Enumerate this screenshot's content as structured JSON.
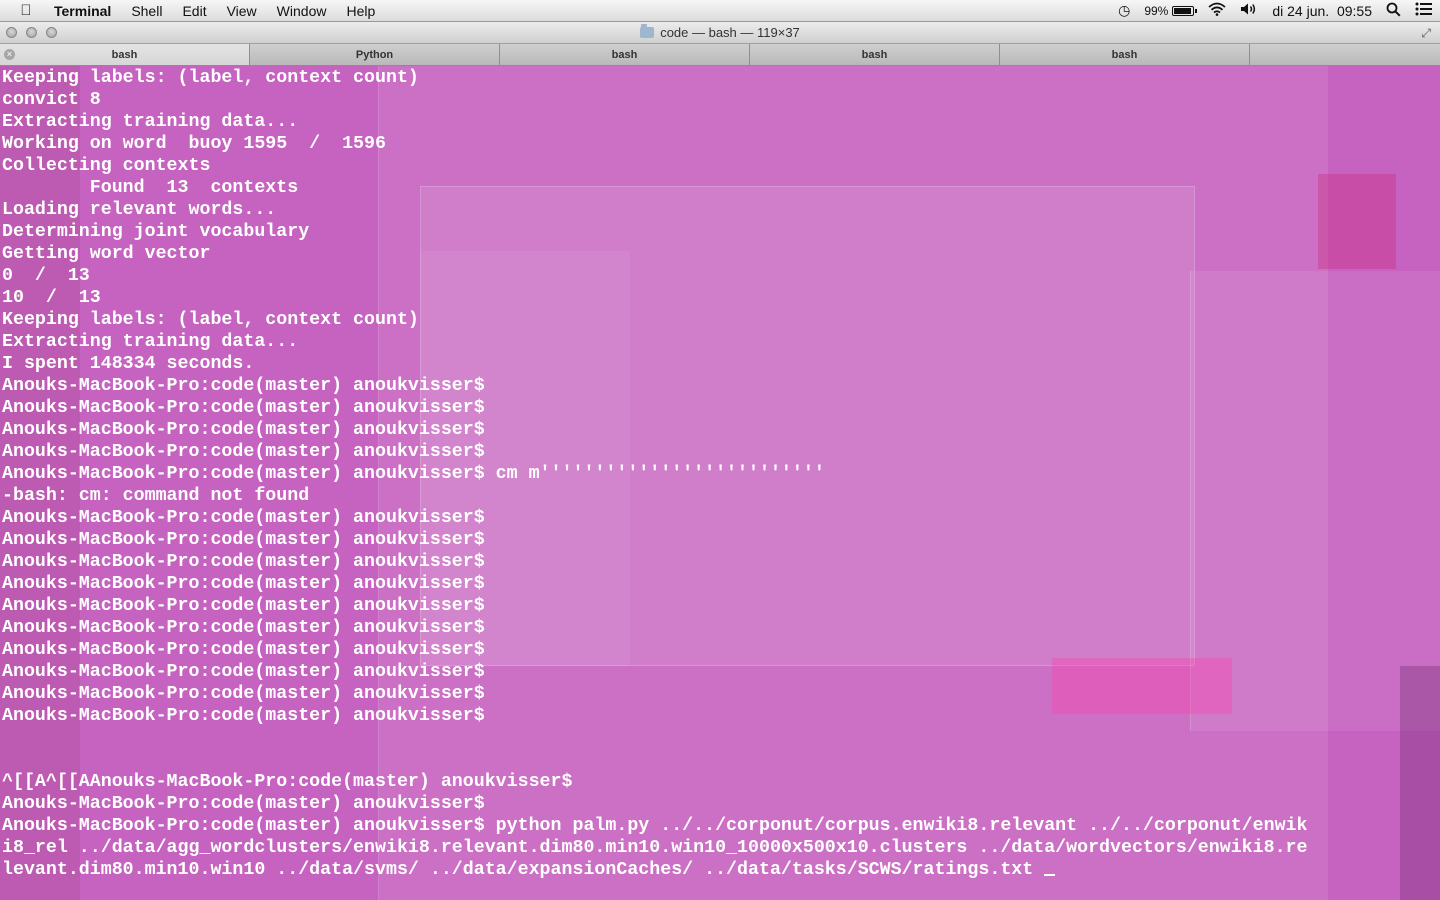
{
  "menubar": {
    "apple_icon": "apple-logo-icon",
    "app_name": "Terminal",
    "menus": [
      "Shell",
      "Edit",
      "View",
      "Window",
      "Help"
    ],
    "battery_percent": "99%",
    "battery_level": 0.99,
    "clock": "di 24 jun.  09:55"
  },
  "window": {
    "title": "code — bash — 119×37"
  },
  "tabs": [
    {
      "label": "bash",
      "active": true
    },
    {
      "label": "Python",
      "active": false
    },
    {
      "label": "bash",
      "active": false
    },
    {
      "label": "bash",
      "active": false
    },
    {
      "label": "bash",
      "active": false
    }
  ],
  "colors": {
    "terminal_background": "#c662c0",
    "terminal_text": "#ffffff"
  },
  "terminal": {
    "lines": [
      "Keeping labels: (label, context count)",
      "convict 8",
      "Extracting training data...",
      "Working on word  buoy 1595  /  1596",
      "Collecting contexts",
      "        Found  13  contexts",
      "Loading relevant words...",
      "Determining joint vocabulary",
      "Getting word vector",
      "0  /  13",
      "10  /  13",
      "Keeping labels: (label, context count)",
      "Extracting training data...",
      "I spent 148334 seconds.",
      "Anouks-MacBook-Pro:code(master) anoukvisser$",
      "Anouks-MacBook-Pro:code(master) anoukvisser$",
      "Anouks-MacBook-Pro:code(master) anoukvisser$",
      "Anouks-MacBook-Pro:code(master) anoukvisser$",
      "Anouks-MacBook-Pro:code(master) anoukvisser$ cm m''''''''''''''''''''''''''",
      "-bash: cm: command not found",
      "Anouks-MacBook-Pro:code(master) anoukvisser$",
      "Anouks-MacBook-Pro:code(master) anoukvisser$",
      "Anouks-MacBook-Pro:code(master) anoukvisser$",
      "Anouks-MacBook-Pro:code(master) anoukvisser$",
      "Anouks-MacBook-Pro:code(master) anoukvisser$",
      "Anouks-MacBook-Pro:code(master) anoukvisser$",
      "Anouks-MacBook-Pro:code(master) anoukvisser$",
      "Anouks-MacBook-Pro:code(master) anoukvisser$",
      "Anouks-MacBook-Pro:code(master) anoukvisser$",
      "Anouks-MacBook-Pro:code(master) anoukvisser$",
      "",
      "",
      "^[[A^[[AAnouks-MacBook-Pro:code(master) anoukvisser$",
      "Anouks-MacBook-Pro:code(master) anoukvisser$",
      "Anouks-MacBook-Pro:code(master) anoukvisser$ python palm.py ../../corponut/corpus.enwiki8.relevant ../../corponut/enwik",
      "i8_rel ../data/agg_wordclusters/enwiki8.relevant.dim80.min10.win10_10000x500x10.clusters ../data/wordvectors/enwiki8.re",
      "levant.dim80.min10.win10 ../data/svms/ ../data/expansionCaches/ ../data/tasks/SCWS/ratings.txt "
    ]
  }
}
